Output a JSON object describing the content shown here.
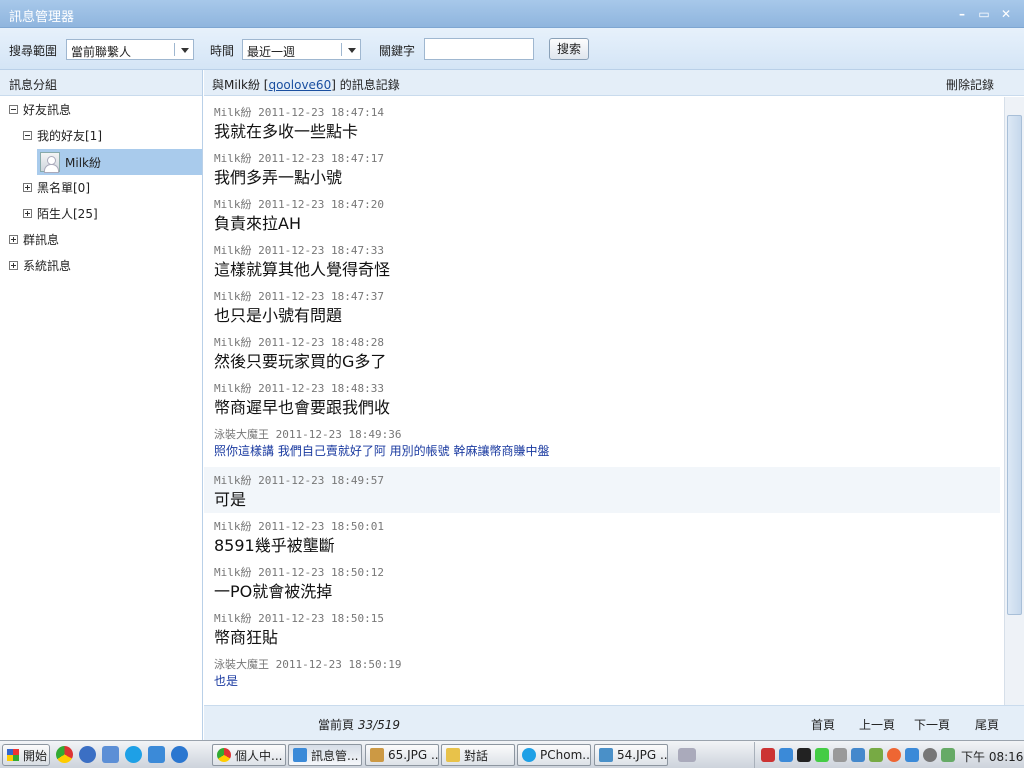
{
  "window": {
    "title": "訊息管理器"
  },
  "toolbar": {
    "scope_label": "搜尋範圍",
    "scope_value": "當前聯繫人",
    "time_label": "時間",
    "time_value": "最近一週",
    "keyword_label": "關鍵字",
    "keyword_value": "",
    "search_label": "搜索"
  },
  "sidebar": {
    "header": "訊息分組",
    "friends_group": "好友訊息",
    "my_friends": "我的好友[1]",
    "selected_contact": "Milk紛",
    "blacklist": "黑名單[0]",
    "strangers": "陌生人[25]",
    "group_messages": "群訊息",
    "system_messages": "系統訊息"
  },
  "conversation": {
    "header_prefix": "與Milk紛 [",
    "contact_id": "qoolove60",
    "header_suffix": "] 的訊息記錄",
    "delete_label": "刪除記錄",
    "messages": [
      {
        "sender": "Milk紛",
        "time": "2011-12-23 18:47:14",
        "text": "我就在多收一些點卡"
      },
      {
        "sender": "Milk紛",
        "time": "2011-12-23 18:47:17",
        "text": "我們多弄一點小號"
      },
      {
        "sender": "Milk紛",
        "time": "2011-12-23 18:47:20",
        "text": "負責來拉AH"
      },
      {
        "sender": "Milk紛",
        "time": "2011-12-23 18:47:33",
        "text": "這樣就算其他人覺得奇怪"
      },
      {
        "sender": "Milk紛",
        "time": "2011-12-23 18:47:37",
        "text": "也只是小號有問題"
      },
      {
        "sender": "Milk紛",
        "time": "2011-12-23 18:48:28",
        "text": "然後只要玩家買的G多了"
      },
      {
        "sender": "Milk紛",
        "time": "2011-12-23 18:48:33",
        "text": "幣商遲早也會要跟我們收"
      },
      {
        "sender": "泳裝大魔王",
        "time": "2011-12-23 18:49:36",
        "text": "照你這樣講 我們自己賣就好了阿 用別的帳號 幹麻讓幣商賺中盤"
      },
      {
        "sender": "Milk紛",
        "time": "2011-12-23 18:49:57",
        "text": "可是"
      },
      {
        "sender": "Milk紛",
        "time": "2011-12-23 18:50:01",
        "text": "8591幾乎被壟斷"
      },
      {
        "sender": "Milk紛",
        "time": "2011-12-23 18:50:12",
        "text": "一PO就會被洗掉"
      },
      {
        "sender": "Milk紛",
        "time": "2011-12-23 18:50:15",
        "text": "幣商狂貼"
      },
      {
        "sender": "泳裝大魔王",
        "time": "2011-12-23 18:50:19",
        "text": "也是"
      }
    ]
  },
  "footer": {
    "page_label": "當前頁",
    "page_value": "33/519",
    "first": "首頁",
    "prev": "上一頁",
    "next": "下一頁",
    "last": "尾頁"
  },
  "taskbar": {
    "start": "開始",
    "tasks": [
      "個人中...",
      "訊息管...",
      "65.JPG ...",
      "對話",
      "PChom...",
      "54.JPG ..."
    ],
    "clock": "下午 08:16"
  },
  "colors": {
    "accent": "#a9cbec",
    "self_text": "#1a3aa0"
  }
}
